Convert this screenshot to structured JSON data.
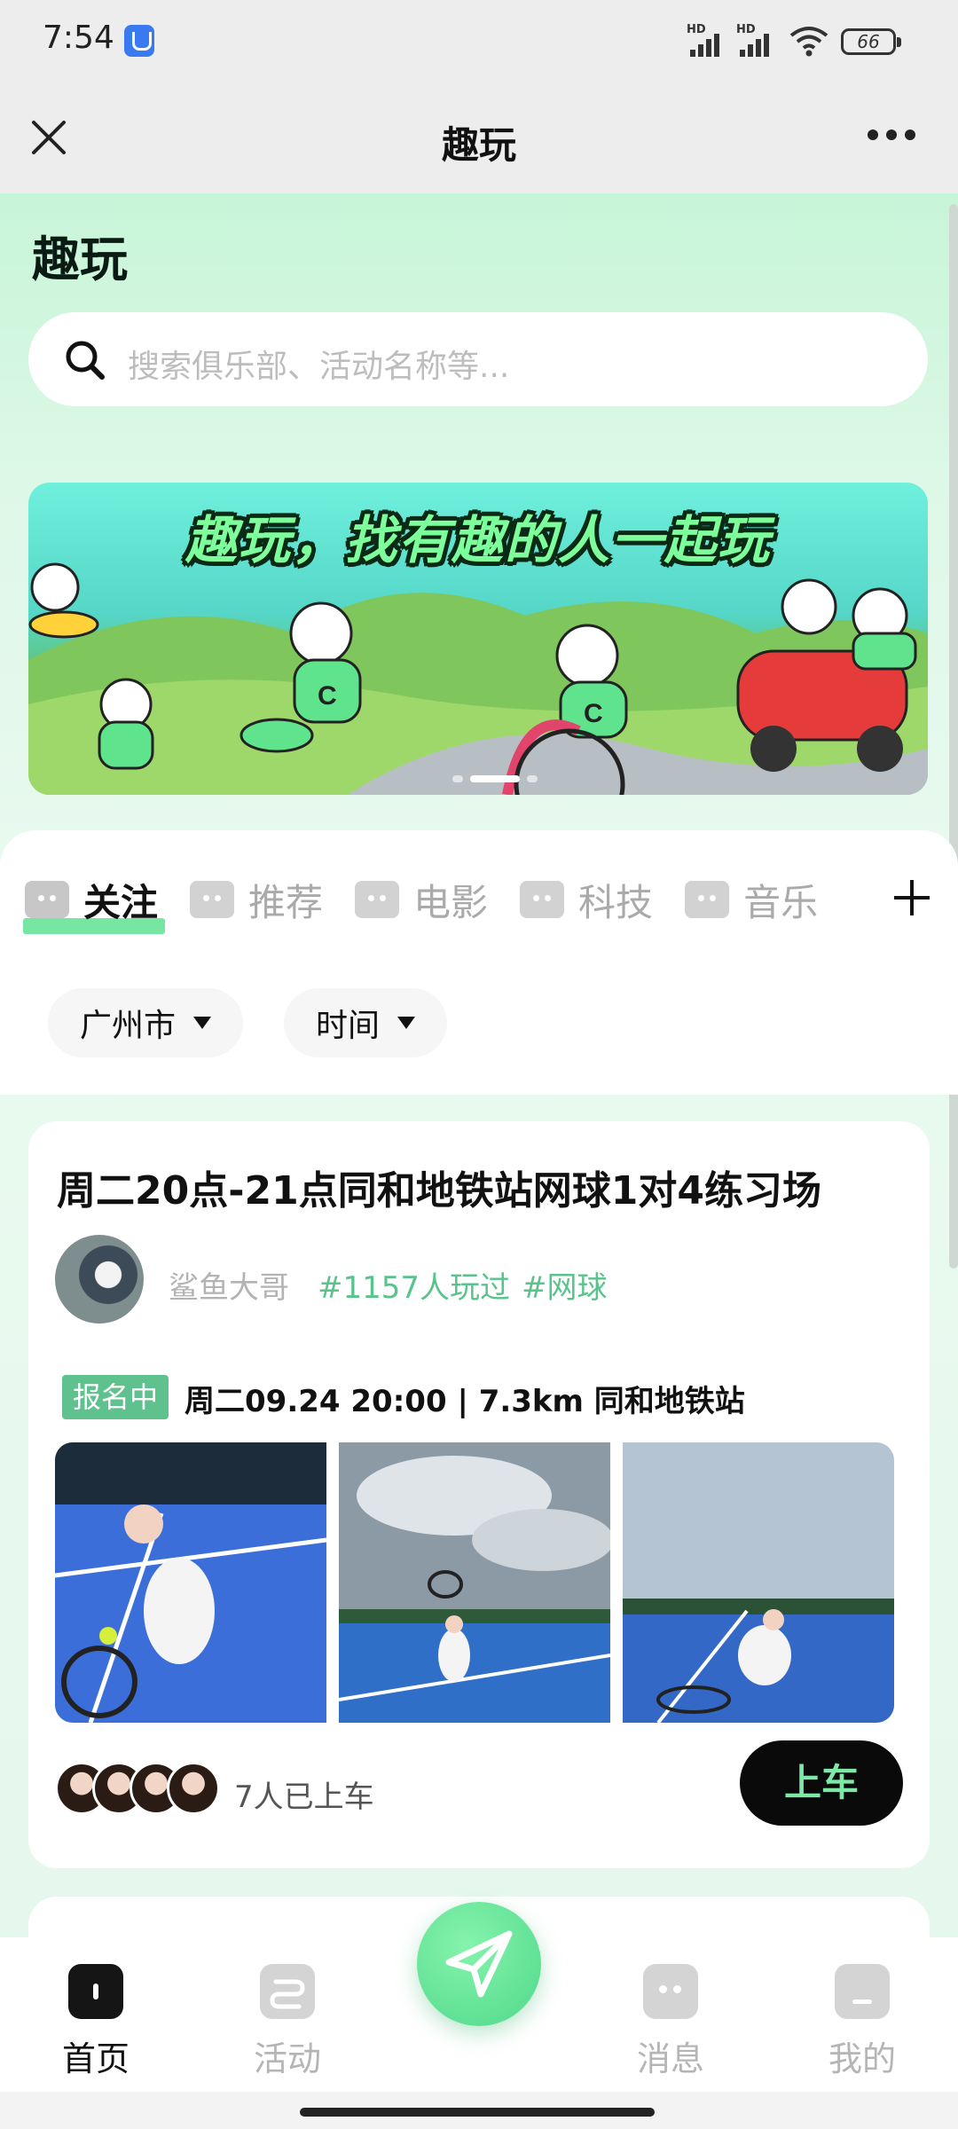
{
  "status_bar": {
    "time": "7:54",
    "signal_label_1": "HD",
    "signal_label_2": "HD",
    "battery": "66"
  },
  "title_bar": {
    "title": "趣玩",
    "close_icon": "close-icon",
    "more_icon": "more-icon"
  },
  "header": {
    "heading": "趣玩"
  },
  "search": {
    "placeholder": "搜索俱乐部、活动名称等..."
  },
  "banner": {
    "headline": "趣玩，找有趣的人一起玩",
    "slide_count": 3,
    "active_slide": 2
  },
  "tabs": [
    {
      "label": "关注",
      "active": true
    },
    {
      "label": "推荐",
      "active": false
    },
    {
      "label": "电影",
      "active": false
    },
    {
      "label": "科技",
      "active": false
    },
    {
      "label": "音乐",
      "active": false
    }
  ],
  "filters": [
    {
      "label": "广州市"
    },
    {
      "label": "时间"
    }
  ],
  "activity": {
    "title": "周二20点-21点同和地铁站网球1对4练习场",
    "author": "鲨鱼大哥",
    "tags": [
      "#1157人玩过",
      "#网球"
    ],
    "status": "报名中",
    "info": "周二09.24 20:00 | 7.3km 同和地铁站",
    "rider_count_text": "7人已上车",
    "button_label": "上车"
  },
  "bottom_nav": [
    {
      "label": "首页",
      "icon": "home-icon",
      "active": true
    },
    {
      "label": "活动",
      "icon": "activity-icon",
      "active": false
    },
    {
      "label": "消息",
      "icon": "message-icon",
      "active": false
    },
    {
      "label": "我的",
      "icon": "profile-icon",
      "active": false
    }
  ],
  "colors": {
    "accent_green": "#5fc28e",
    "button_text_green": "#7ee8a7",
    "tag_green": "#59c38c"
  }
}
